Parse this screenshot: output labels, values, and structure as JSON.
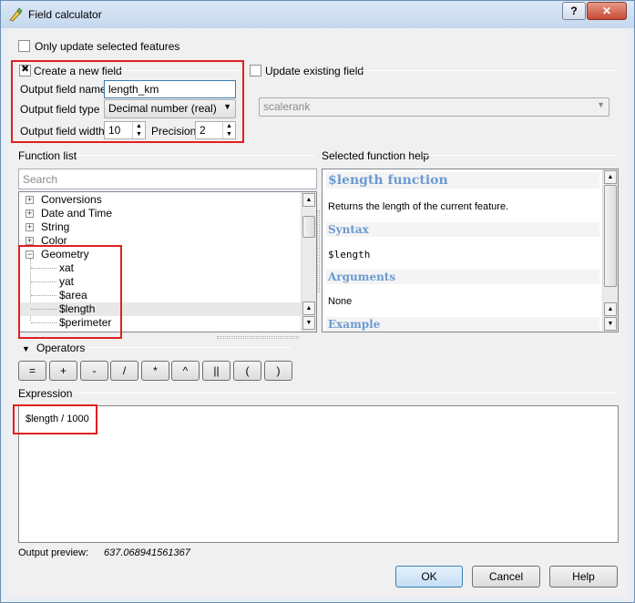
{
  "window": {
    "title": "Field calculator",
    "help_button": "?",
    "close_button": "✕"
  },
  "only_selected": {
    "label": "Only update selected features",
    "checked": false
  },
  "create_field": {
    "label": "Create a new field",
    "checked": true,
    "output_field_name_label": "Output field name",
    "output_field_name_value": "length_km",
    "output_field_type_label": "Output field type",
    "output_field_type_value": "Decimal number (real)",
    "output_field_width_label": "Output field width",
    "output_field_width_value": "10",
    "precision_label": "Precision",
    "precision_value": "2"
  },
  "update_existing": {
    "label": "Update existing field",
    "checked": false,
    "field_value": "scalerank"
  },
  "function_list": {
    "label": "Function list",
    "search_placeholder": "Search",
    "groups": [
      {
        "label": "Conversions",
        "expander": "+"
      },
      {
        "label": "Date and Time",
        "expander": "+"
      },
      {
        "label": "String",
        "expander": "+"
      },
      {
        "label": "Color",
        "expander": "+"
      },
      {
        "label": "Geometry",
        "expander": "−"
      }
    ],
    "geometry_items": [
      "xat",
      "yat",
      "$area",
      "$length",
      "$perimeter"
    ],
    "selected_item": "$length"
  },
  "function_help": {
    "label": "Selected function help",
    "title": "$length function",
    "description": "Returns the length of the current feature.",
    "syntax_heading": "Syntax",
    "syntax": "$length",
    "arguments_heading": "Arguments",
    "arguments": "None",
    "example_heading": "Example"
  },
  "operators": {
    "label": "Operators",
    "buttons": [
      "=",
      "+",
      "-",
      "/",
      "*",
      "^",
      "||",
      "(",
      ")"
    ]
  },
  "expression": {
    "label": "Expression",
    "value": "$length / 1000"
  },
  "preview": {
    "label": "Output preview:",
    "value": "637.068941561367"
  },
  "buttons": {
    "ok": "OK",
    "cancel": "Cancel",
    "help": "Help"
  }
}
